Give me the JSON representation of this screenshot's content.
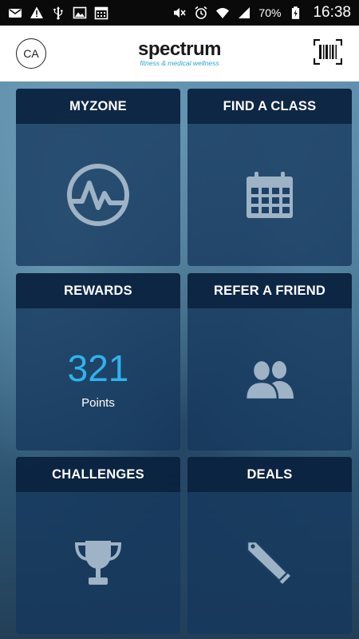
{
  "status_bar": {
    "battery_percent": "70%",
    "clock": "16:38",
    "icons": [
      "mail-icon",
      "warning-icon",
      "usb-icon",
      "image-icon",
      "calendar-icon",
      "mute-icon",
      "alarm-icon",
      "wifi-icon",
      "signal-icon",
      "battery-charging-icon"
    ]
  },
  "header": {
    "avatar_initials": "CA",
    "logo_name": "spectrum",
    "logo_tagline": "fitness & medical wellness",
    "barcode_icon": "barcode-icon"
  },
  "tiles": [
    {
      "title": "MYZONE",
      "icon": "heartrate-gauge-icon"
    },
    {
      "title": "FIND A CLASS",
      "icon": "calendar-icon"
    },
    {
      "title": "REWARDS",
      "points_value": "321",
      "points_label": "Points"
    },
    {
      "title": "REFER A FRIEND",
      "icon": "users-icon"
    },
    {
      "title": "CHALLENGES",
      "icon": "trophy-icon"
    },
    {
      "title": "DEALS",
      "icon": "tag-icon"
    }
  ],
  "colors": {
    "accent": "#2fb3ee",
    "tile_bg": "#14375c",
    "tile_header": "#081e3a",
    "icon_fill": "#9fb3c6"
  }
}
